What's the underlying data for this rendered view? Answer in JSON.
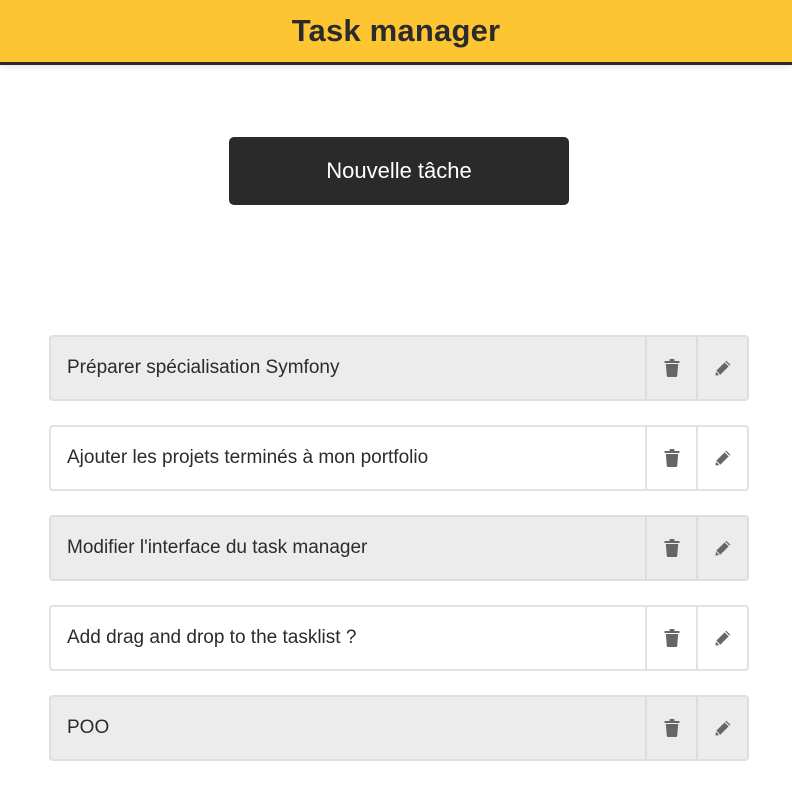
{
  "header": {
    "title": "Task manager"
  },
  "actions": {
    "new_task_label": "Nouvelle tâche"
  },
  "tasks": [
    {
      "label": "Préparer spécialisation Symfony",
      "shaded": true
    },
    {
      "label": "Ajouter les projets terminés à mon portfolio",
      "shaded": false
    },
    {
      "label": "Modifier l'interface du task manager",
      "shaded": true
    },
    {
      "label": "Add drag and drop to the tasklist ?",
      "shaded": false
    },
    {
      "label": "POO",
      "shaded": true
    }
  ],
  "icons": {
    "delete": "trash-icon",
    "edit": "pencil-icon"
  },
  "colors": {
    "header_bg": "#fdc532",
    "header_text": "#2b2b2b",
    "button_bg": "#2a2a2a",
    "button_text": "#ffffff",
    "row_shaded": "#ececec",
    "icon": "#666666"
  }
}
